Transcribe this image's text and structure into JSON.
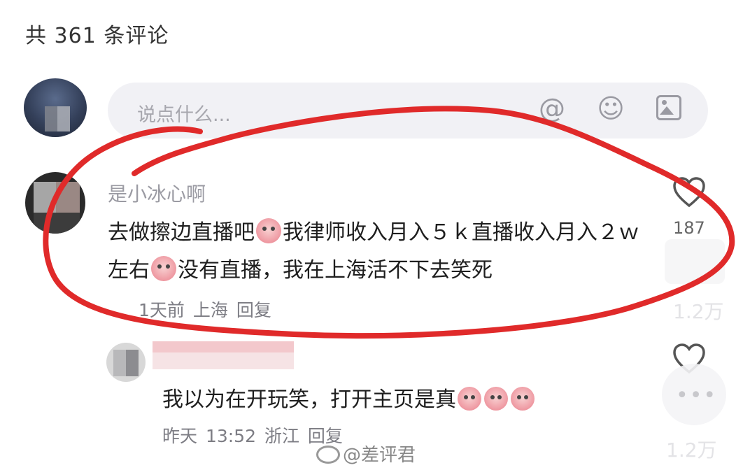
{
  "header": {
    "comment_count": "共 361 条评论"
  },
  "input": {
    "placeholder": "说点什么..."
  },
  "icons": {
    "at": "at-icon",
    "emoji": "emoji-icon",
    "image": "image-icon",
    "like": "heart-icon"
  },
  "comment": {
    "author": "是小冰心啊",
    "text_a": "去做擦边直播吧",
    "text_b": "我律师收入月入５ｋ直播收入月入２ｗ左右",
    "text_c": "没有直播，我在上海活不下去笑死",
    "time": "1天前",
    "location": "上海",
    "reply_label": "回复",
    "likes": "187"
  },
  "reply": {
    "text": "我以为在开玩笑，打开主页是真",
    "time": "昨天 13:52",
    "location": "浙江",
    "reply_label": "回复"
  },
  "side": {
    "faded_count_1": "1.2万",
    "faded_count_2": "1.2万"
  },
  "watermark": {
    "text": "@差评君"
  },
  "colors": {
    "annotation_red": "#e02a2a",
    "input_bg": "#f1f1f5",
    "meta_gray": "#7d7d84"
  }
}
